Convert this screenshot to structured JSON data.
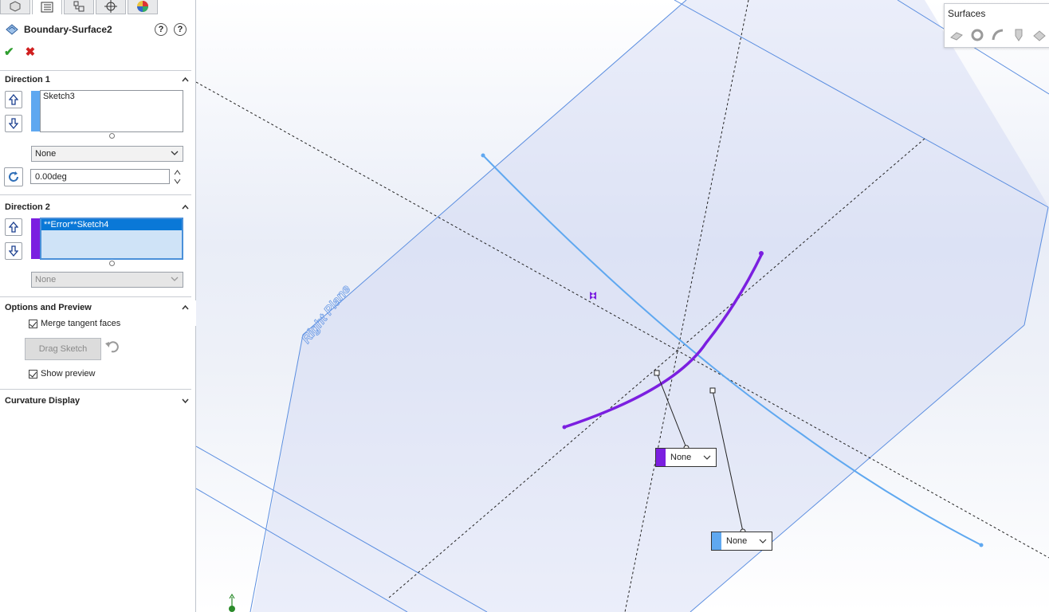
{
  "feature": {
    "title": "Boundary-Surface2",
    "help1": "?",
    "help2": "?",
    "ok": "✔",
    "cancel": "✖"
  },
  "direction1": {
    "header": "Direction 1",
    "items": [
      "Sketch3"
    ],
    "color": "#5fa8f0",
    "tangency": "None",
    "angle": "0.00deg"
  },
  "direction2": {
    "header": "Direction 2",
    "items": [
      "**Error**Sketch4"
    ],
    "color": "#7b1fe0",
    "tangency": "None"
  },
  "options": {
    "header": "Options and Preview",
    "merge_tangent": "Merge tangent faces",
    "merge_checked": true,
    "drag_sketch": "Drag Sketch",
    "show_preview": "Show preview",
    "preview_checked": true
  },
  "curvature": {
    "header": "Curvature Display"
  },
  "toolbar": {
    "title": "Surfaces"
  },
  "viewport": {
    "plane_label": "Right Plane",
    "callout1": {
      "value": "None",
      "color": "#7b1fe0"
    },
    "callout2": {
      "value": "None",
      "color": "#5fa8f0"
    }
  }
}
